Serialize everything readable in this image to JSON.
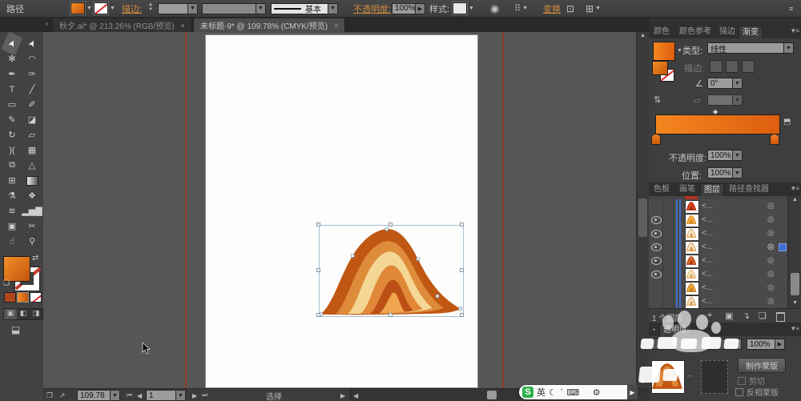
{
  "app": {
    "context_label": "路径",
    "accent_orange": "#cf8c3c"
  },
  "control_bar": {
    "stroke_link": "描边:",
    "brush_value": "基本",
    "opacity_link": "不透明度:",
    "opacity_value": "100%",
    "style_label": "样式:",
    "transform_link": "变换"
  },
  "document_tabs": [
    {
      "label": "秋夕.ai* @ 213.26% (RGB/预览)",
      "close": "×",
      "active": false
    },
    {
      "label": "未标题-9* @ 109.78% (CMYK/预览)",
      "close": "×",
      "active": true
    }
  ],
  "tools": {
    "rows": [
      [
        {
          "name": "selection-tool",
          "glyph": "➤",
          "selected": true
        },
        {
          "name": "direct-selection-tool",
          "glyph": "➤",
          "selected": false
        }
      ],
      [
        {
          "name": "magic-wand-tool",
          "glyph": "✻"
        },
        {
          "name": "lasso-tool",
          "glyph": "◠"
        }
      ],
      [
        {
          "name": "pen-tool",
          "glyph": "✒"
        },
        {
          "name": "curvature-pen-tool",
          "glyph": "✑"
        }
      ],
      [
        {
          "name": "type-tool",
          "glyph": "T"
        },
        {
          "name": "line-segment-tool",
          "glyph": "╱"
        }
      ],
      [
        {
          "name": "rectangle-tool",
          "glyph": "▭"
        },
        {
          "name": "paintbrush-tool",
          "glyph": "✐"
        }
      ],
      [
        {
          "name": "pencil-tool",
          "glyph": "✎"
        },
        {
          "name": "eraser-tool",
          "glyph": "◪"
        }
      ],
      [
        {
          "name": "rotate-tool",
          "glyph": "↻"
        },
        {
          "name": "scale-tool",
          "glyph": "▱"
        }
      ],
      [
        {
          "name": "width-tool",
          "glyph": ")("
        },
        {
          "name": "free-transform-tool",
          "glyph": "▦"
        }
      ],
      [
        {
          "name": "shape-builder-tool",
          "glyph": "⧉"
        },
        {
          "name": "perspective-grid-tool",
          "glyph": "△"
        }
      ],
      [
        {
          "name": "mesh-tool",
          "glyph": "⊞"
        },
        {
          "name": "gradient-tool",
          "glyph": ""
        }
      ],
      [
        {
          "name": "eyedropper-tool",
          "glyph": "⚗"
        },
        {
          "name": "blend-tool",
          "glyph": "❖"
        }
      ],
      [
        {
          "name": "symbol-sprayer-tool",
          "glyph": "≋"
        },
        {
          "name": "column-graph-tool",
          "glyph": "▂▅▇"
        }
      ],
      [
        {
          "name": "artboard-tool",
          "glyph": "▣"
        },
        {
          "name": "slice-tool",
          "glyph": "✂"
        }
      ],
      [
        {
          "name": "hand-tool",
          "glyph": "☝"
        },
        {
          "name": "zoom-tool",
          "glyph": "⚲"
        }
      ]
    ]
  },
  "toolbar_swatches": {
    "fill_gradient": [
      "#f49026",
      "#c2540e"
    ],
    "solid_mode": "#b0471a"
  },
  "artwork": {
    "bands": [
      "#c05713",
      "#de8b3a",
      "#f4d794",
      "#e08838",
      "#bc4f15",
      "#efa64e"
    ],
    "selection_color": "#a8bfce"
  },
  "gradient_panel": {
    "tabs": [
      "颜色",
      "颜色参考",
      "描边",
      "渐变"
    ],
    "active_tab": "渐变",
    "type_label": "类型:",
    "type_value": "线性",
    "stroke_label": "描边:",
    "angle_value": "0°",
    "opacity_label": "不透明度:",
    "opacity_value": "100%",
    "position_label": "位置:",
    "position_value": "100%",
    "bar_colors": [
      "#f4861f",
      "#dd5e0f"
    ]
  },
  "layers_panel": {
    "tabs": [
      "色板",
      "画笔",
      "图层",
      "路径查找器"
    ],
    "active_tab": "图层",
    "row_label": "<...",
    "rows": [
      {
        "eye": false,
        "thumb": [
          "#d8431e",
          "#a82a10"
        ],
        "selected": false
      },
      {
        "eye": true,
        "thumb": [
          "#f0b243",
          "#d88a20"
        ],
        "selected": false
      },
      {
        "eye": true,
        "thumb": [
          "#f6eadb",
          "#e0a050"
        ],
        "selected": false
      },
      {
        "eye": true,
        "thumb": [
          "#f3e7cf",
          "#d89040"
        ],
        "selected": true
      },
      {
        "eye": true,
        "thumb": [
          "#d4682a",
          "#b03a12"
        ],
        "selected": false
      },
      {
        "eye": true,
        "thumb": [
          "#f2e2c2",
          "#e0a860"
        ],
        "selected": false
      },
      {
        "eye": false,
        "thumb": [
          "#e9a93c",
          "#c87818"
        ],
        "selected": false
      },
      {
        "eye": false,
        "thumb": [
          "#f2e2c2",
          "#dba258"
        ],
        "selected": false
      }
    ],
    "footer": "1 个图层"
  },
  "transparency_panel": {
    "tab": "透明度",
    "opacity_value": "100%",
    "make_mask": "制作蒙版",
    "clip_label": "剪切",
    "invert_label": "反相蒙版",
    "thumb_colors": [
      "#e08838",
      "#c05713"
    ]
  },
  "status_bar": {
    "zoom_value": "109.78",
    "artboard_value": "1",
    "status": "选择"
  },
  "ime": {
    "logo": "S",
    "mode": "英",
    "icons": [
      {
        "name": "moon-icon",
        "glyph": "☾"
      },
      {
        "name": "punctuation-icon",
        "glyph": "’"
      },
      {
        "name": "keyboard-icon",
        "glyph": "⌨"
      },
      {
        "name": "skin-icon",
        "glyph": "◌"
      },
      {
        "name": "toolbox-icon",
        "glyph": "⚙"
      }
    ]
  }
}
